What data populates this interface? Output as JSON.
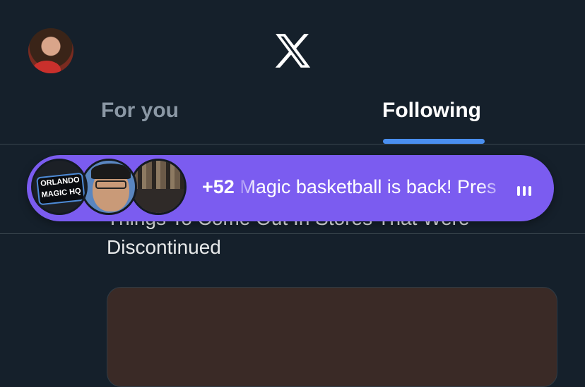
{
  "header": {
    "logo_icon": "x-logo-icon",
    "tabs": [
      {
        "label": "For you",
        "active": false
      },
      {
        "label": "Following",
        "active": true
      }
    ],
    "accent": "#4a8ff0"
  },
  "spaces_pill": {
    "count": "+52",
    "message": "Magic basketball is back! Pres",
    "avatars": [
      {
        "alt_text": "ORLANDO"
      },
      {
        "alt_text": "MAGIC HQ"
      }
    ],
    "audio_icon": "audio-bars-icon",
    "color": "#7b5cf0"
  },
  "tweet": {
    "title_partial": "Things To Come Out In Stores That Were",
    "title_end": "Discontinued"
  }
}
